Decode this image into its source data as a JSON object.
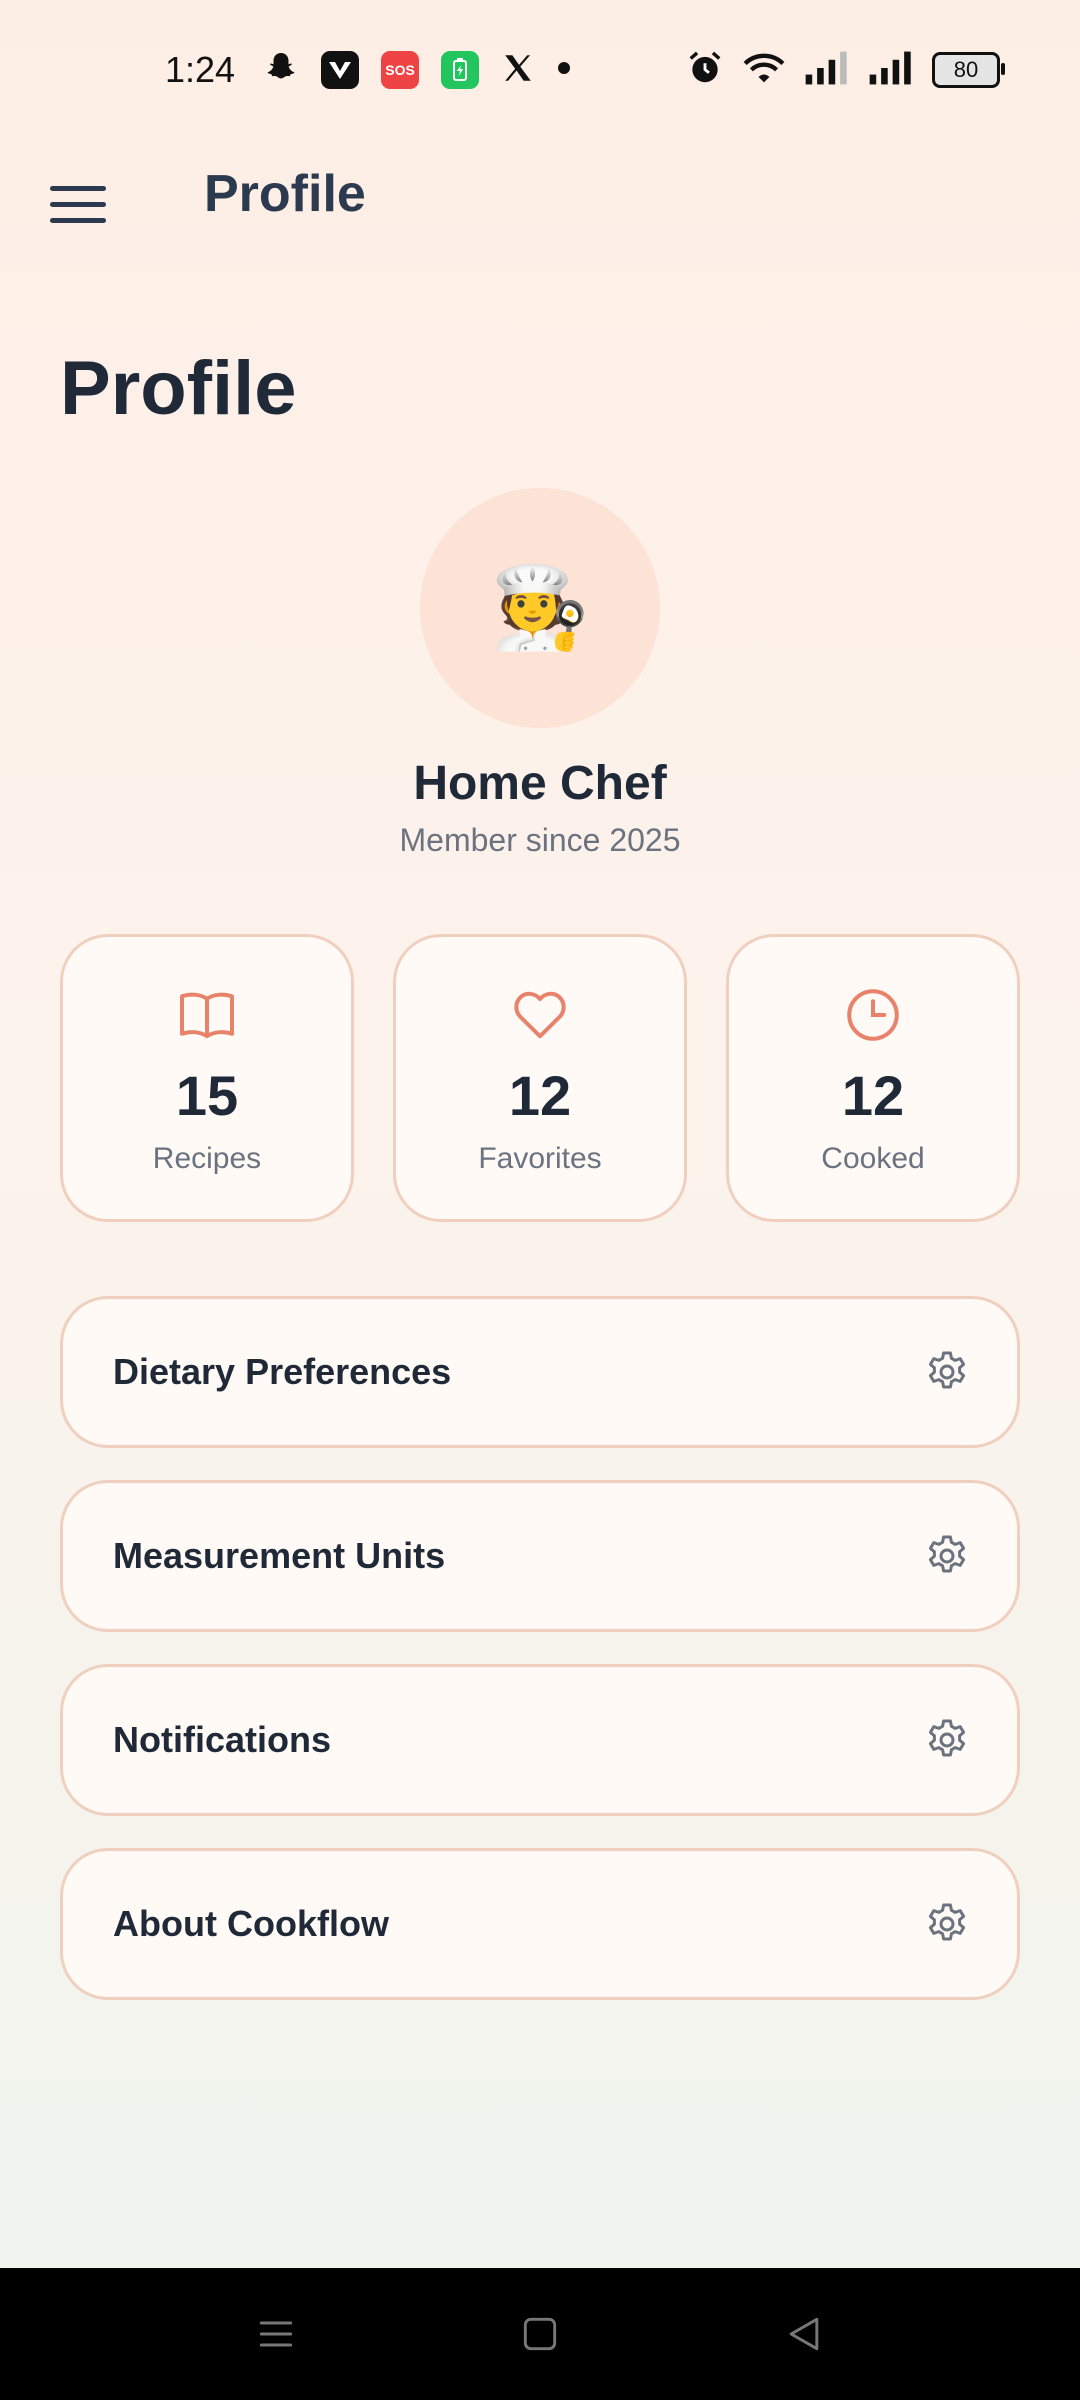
{
  "status_bar": {
    "time": "1:24",
    "notification_icons": [
      "snapchat-icon",
      "v-app-icon",
      "sos-icon",
      "battery-saver-icon",
      "x-icon",
      "dot-icon"
    ],
    "sos_label": "SOS",
    "battery_level": "80"
  },
  "app_bar": {
    "title": "Profile"
  },
  "page": {
    "title": "Profile"
  },
  "profile": {
    "avatar_emoji": "🧑‍🍳",
    "name": "Home Chef",
    "member_since": "Member since 2025"
  },
  "stats": [
    {
      "icon": "book-icon",
      "value": "15",
      "label": "Recipes"
    },
    {
      "icon": "heart-icon",
      "value": "12",
      "label": "Favorites"
    },
    {
      "icon": "clock-icon",
      "value": "12",
      "label": "Cooked"
    }
  ],
  "settings": [
    {
      "label": "Dietary Preferences",
      "icon": "gear-icon"
    },
    {
      "label": "Measurement Units",
      "icon": "gear-icon"
    },
    {
      "label": "Notifications",
      "icon": "gear-icon"
    },
    {
      "label": "About Cookflow",
      "icon": "gear-icon"
    }
  ],
  "colors": {
    "accent": "#e8826a",
    "card_border": "#f1cfbf",
    "title_text": "#2b3a4e",
    "muted_text": "#6b7280"
  }
}
